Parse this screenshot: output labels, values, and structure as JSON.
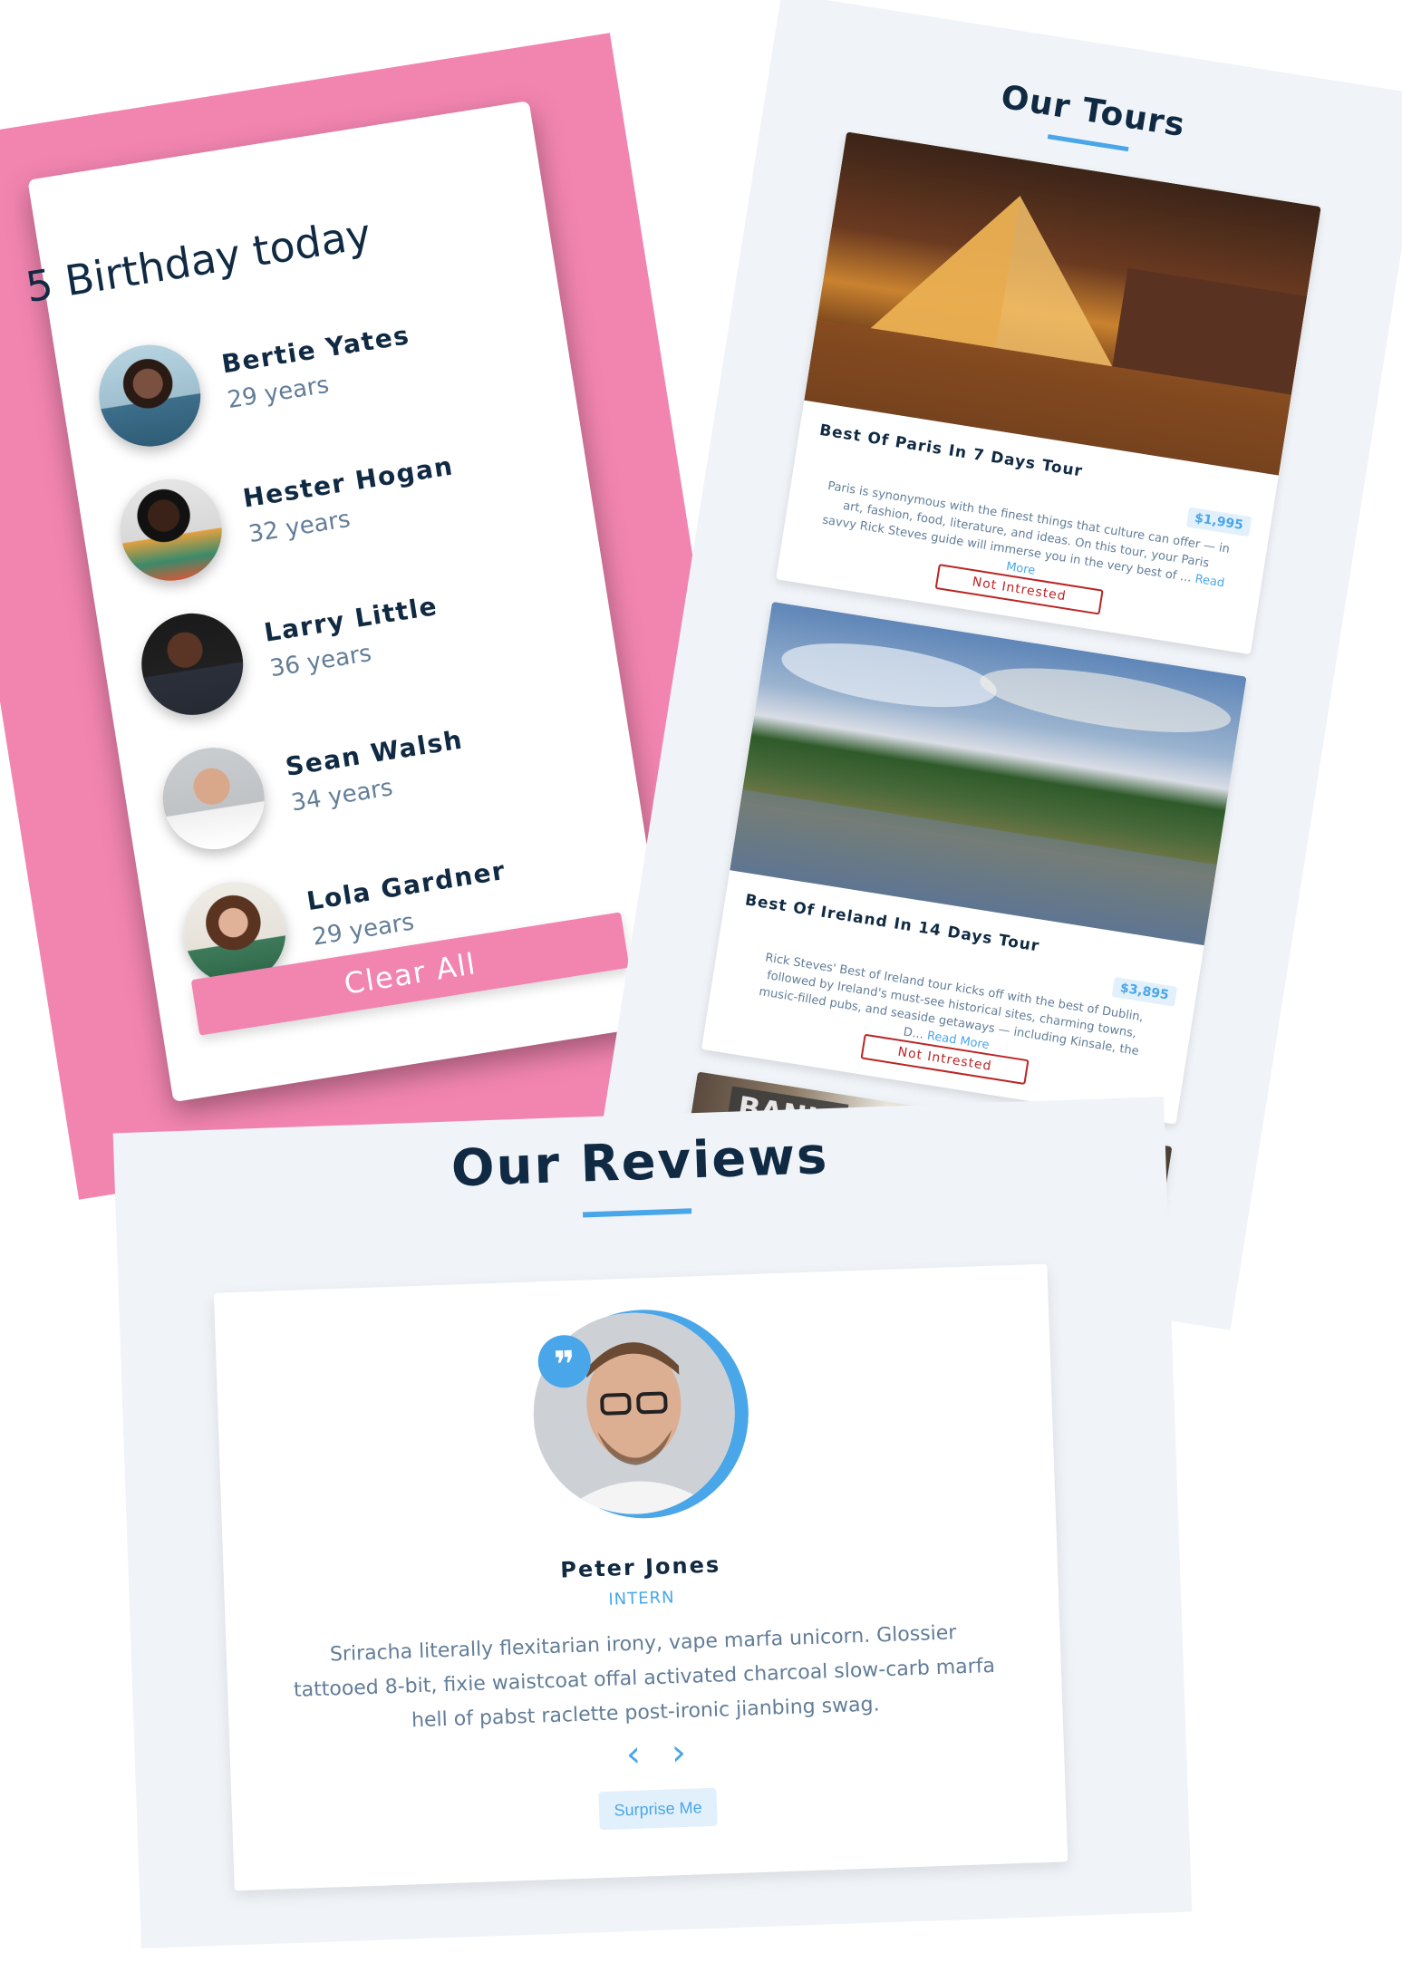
{
  "birthday": {
    "title": "5 Birthday today",
    "people": [
      {
        "name": "Bertie Yates",
        "age": "29 years"
      },
      {
        "name": "Hester Hogan",
        "age": "32 years"
      },
      {
        "name": "Larry Little",
        "age": "36 years"
      },
      {
        "name": "Sean Walsh",
        "age": "34 years"
      },
      {
        "name": "Lola Gardner",
        "age": "29 years"
      }
    ],
    "clear_label": "Clear All",
    "accent": "#f285b0"
  },
  "tours": {
    "title": "Our Tours",
    "items": [
      {
        "name": "Best Of Paris In 7 Days Tour",
        "price": "$1,995",
        "info": "Paris is synonymous with the finest things that culture can offer — in art, fashion, food, literature, and ideas. On this tour, your Paris savvy Rick Steves guide will immerse you in the very best of ...",
        "read_more": "Read More",
        "not_interested": "Not Intrested"
      },
      {
        "name": "Best Of Ireland In 14 Days Tour",
        "price": "$3,895",
        "info": "Rick Steves' Best of Ireland tour kicks off with the best of Dublin, followed by Ireland's must-see historical sites, charming towns, music-filled pubs, and seaside getaways — including Kinsale, the D...",
        "read_more": "Read More",
        "not_interested": "Not Intrested"
      },
      {
        "sign": "BANK"
      }
    ]
  },
  "reviews": {
    "title": "Our Reviews",
    "name": "Peter Jones",
    "job": "INTERN",
    "text": "Sriracha literally flexitarian irony, vape marfa unicorn. Glossier tattooed 8-bit, fixie waistcoat offal activated charcoal slow-carb marfa hell of pabst raclette post-ironic jianbing swag.",
    "quote": "❞",
    "prev": "‹",
    "next": "›",
    "surprise_label": "Surprise Me",
    "accent": "#49a6e9"
  }
}
